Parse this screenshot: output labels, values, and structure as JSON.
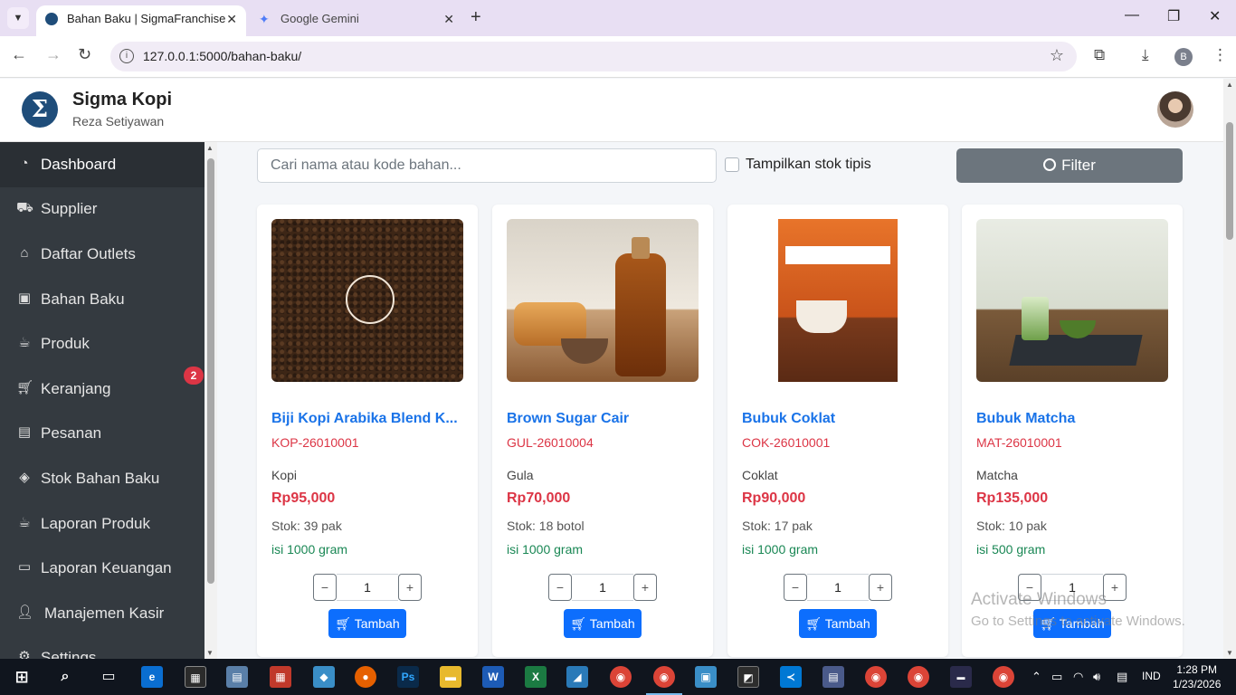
{
  "browser": {
    "tabs": [
      {
        "title": "Bahan Baku | SigmaFranchise",
        "active": true
      },
      {
        "title": "Google Gemini",
        "active": false
      }
    ],
    "url": "127.0.0.1:5000/bahan-baku/"
  },
  "header": {
    "brand": "Sigma Kopi",
    "user": "Reza Setiyawan"
  },
  "sidebar": {
    "items": [
      {
        "label": "Dashboard",
        "icon": "dashboard-icon",
        "active": true
      },
      {
        "label": "Supplier",
        "icon": "truck-icon"
      },
      {
        "label": "Daftar Outlets",
        "icon": "store-icon"
      },
      {
        "label": "Bahan Baku",
        "icon": "box-icon"
      },
      {
        "label": "Produk",
        "icon": "mug-icon"
      },
      {
        "label": "Keranjang",
        "icon": "cart-icon"
      },
      {
        "label": "Pesanan",
        "icon": "receipt-icon"
      },
      {
        "label": "Stok Bahan Baku",
        "icon": "boxes-icon"
      },
      {
        "label": "Laporan Produk",
        "icon": "mug-icon"
      },
      {
        "label": "Laporan Keuangan",
        "icon": "wallet-icon"
      },
      {
        "label": "Manajemen Kasir",
        "icon": "user-icon"
      },
      {
        "label": "Settings",
        "icon": "gear-icon"
      }
    ],
    "cart_badge": "2"
  },
  "filters": {
    "search_placeholder": "Cari nama atau kode bahan...",
    "low_stock_label": "Tampilkan stok tipis",
    "filter_label": "Filter"
  },
  "products": [
    {
      "name": "Biji Kopi Arabika Blend K...",
      "code": "KOP-26010001",
      "category": "Kopi",
      "price": "Rp95,000",
      "stock": "Stok: 39 pak",
      "content": "isi 1000 gram",
      "qty": "1",
      "add_label": "Tambah"
    },
    {
      "name": "Brown Sugar Cair",
      "code": "GUL-26010004",
      "category": "Gula",
      "price": "Rp70,000",
      "stock": "Stok: 18 botol",
      "content": "isi 1000 gram",
      "qty": "1",
      "add_label": "Tambah"
    },
    {
      "name": "Bubuk Coklat",
      "code": "COK-26010001",
      "category": "Coklat",
      "price": "Rp90,000",
      "stock": "Stok: 17 pak",
      "content": "isi 1000 gram",
      "qty": "1",
      "add_label": "Tambah"
    },
    {
      "name": "Bubuk Matcha",
      "code": "MAT-26010001",
      "category": "Matcha",
      "price": "Rp135,000",
      "stock": "Stok: 10 pak",
      "content": "isi 500 gram",
      "qty": "1",
      "add_label": "Tambah"
    }
  ],
  "watermark": {
    "line1": "Activate Windows",
    "line2": "Go to Settings to activate Windows."
  },
  "taskbar": {
    "lang": "IND",
    "time": "1:28 PM",
    "date": "1/23/2026"
  },
  "colors": {
    "sidebar_bg": "#343a40",
    "link_blue": "#1a73e8",
    "price_red": "#dc3545",
    "content_green": "#198754",
    "primary_button": "#0d6efd",
    "filter_button": "#6c757d"
  }
}
